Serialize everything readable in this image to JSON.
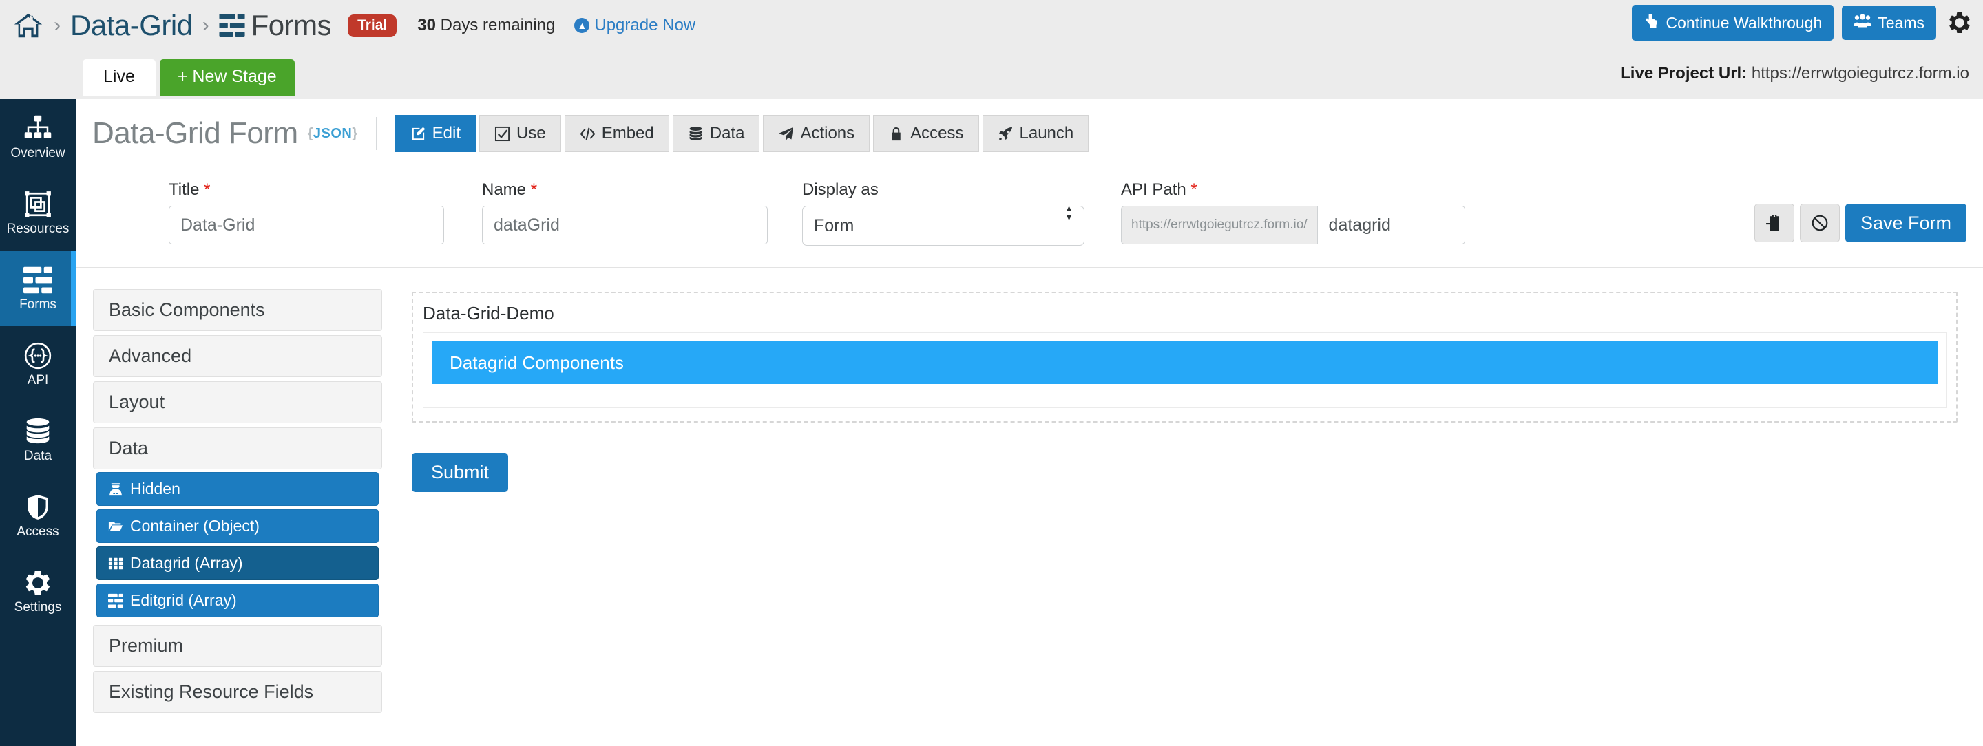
{
  "topbar": {
    "home_icon": "home-icon",
    "breadcrumb": [
      {
        "label": "Data-Grid",
        "type": "link"
      },
      {
        "label": "Forms",
        "type": "section"
      }
    ],
    "separator": "›",
    "trial_badge": "Trial",
    "days_number": "30",
    "days_text": "Days remaining",
    "upgrade_label": "Upgrade Now",
    "upgrade_icon": "arrow-up-circle-icon",
    "walkthrough_label": "Continue Walkthrough",
    "walkthrough_icon": "hand-pointer-icon",
    "teams_label": "Teams",
    "teams_icon": "users-icon",
    "gear_icon": "gear-icon",
    "accent_blue": "#1c7cc0",
    "trial_red": "#c0392b"
  },
  "subbar": {
    "stage_tab": "Live",
    "new_stage": "+ New Stage",
    "new_stage_green": "#4aa42a",
    "live_url_label": "Live Project Url:",
    "live_url_value": "https://errwtgoiegutrcz.form.io"
  },
  "leftnav": {
    "items": [
      {
        "label": "Overview",
        "icon": "sitemap-icon",
        "active": false
      },
      {
        "label": "Resources",
        "icon": "resources-icon",
        "active": false
      },
      {
        "label": "Forms",
        "icon": "forms-icon",
        "active": true
      },
      {
        "label": "API",
        "icon": "api-braces-icon",
        "active": false
      },
      {
        "label": "Data",
        "icon": "database-icon",
        "active": false
      },
      {
        "label": "Access",
        "icon": "shield-icon",
        "active": false
      },
      {
        "label": "Settings",
        "icon": "gear-icon",
        "active": false
      }
    ]
  },
  "form_header": {
    "title": "Data-Grid Form",
    "json_tag_open": "{",
    "json_tag_word": "JSON",
    "json_tag_close": "}",
    "tabs": [
      {
        "label": "Edit",
        "icon": "edit-icon",
        "active": true
      },
      {
        "label": "Use",
        "icon": "checkbox-icon",
        "active": false
      },
      {
        "label": "Embed",
        "icon": "code-icon",
        "active": false
      },
      {
        "label": "Data",
        "icon": "database-icon",
        "active": false
      },
      {
        "label": "Actions",
        "icon": "paper-plane-icon",
        "active": false
      },
      {
        "label": "Access",
        "icon": "lock-icon",
        "active": false
      },
      {
        "label": "Launch",
        "icon": "rocket-icon",
        "active": false
      }
    ]
  },
  "settings": {
    "title_label": "Title",
    "title_value": "Data-Grid",
    "name_label": "Name",
    "name_value": "dataGrid",
    "display_label": "Display as",
    "display_value": "Form",
    "api_path_label": "API Path",
    "api_path_prefix": "https://errwtgoiegutrcz.form.io/",
    "api_path_value": "datagrid",
    "required_marker": "*",
    "import_icon": "import-clipboard-icon",
    "cancel_icon": "ban-icon",
    "save_label": "Save Form"
  },
  "builder": {
    "groups": [
      {
        "label": "Basic Components",
        "expanded": false
      },
      {
        "label": "Advanced",
        "expanded": false
      },
      {
        "label": "Layout",
        "expanded": false
      },
      {
        "label": "Data",
        "expanded": true
      }
    ],
    "data_components": [
      {
        "label": "Hidden",
        "icon": "user-secret-icon",
        "hover": false
      },
      {
        "label": "Container (Object)",
        "icon": "folder-open-icon",
        "hover": false
      },
      {
        "label": "Datagrid (Array)",
        "icon": "th-grid-icon",
        "hover": true
      },
      {
        "label": "Editgrid (Array)",
        "icon": "list-rows-icon",
        "hover": false
      }
    ],
    "groups_after": [
      {
        "label": "Premium",
        "expanded": false
      },
      {
        "label": "Existing Resource Fields",
        "expanded": false
      }
    ]
  },
  "canvas": {
    "panel_title": "Data-Grid-Demo",
    "datagrid_label": "Datagrid Components",
    "datagrid_color": "#26a8f7",
    "submit_label": "Submit"
  }
}
